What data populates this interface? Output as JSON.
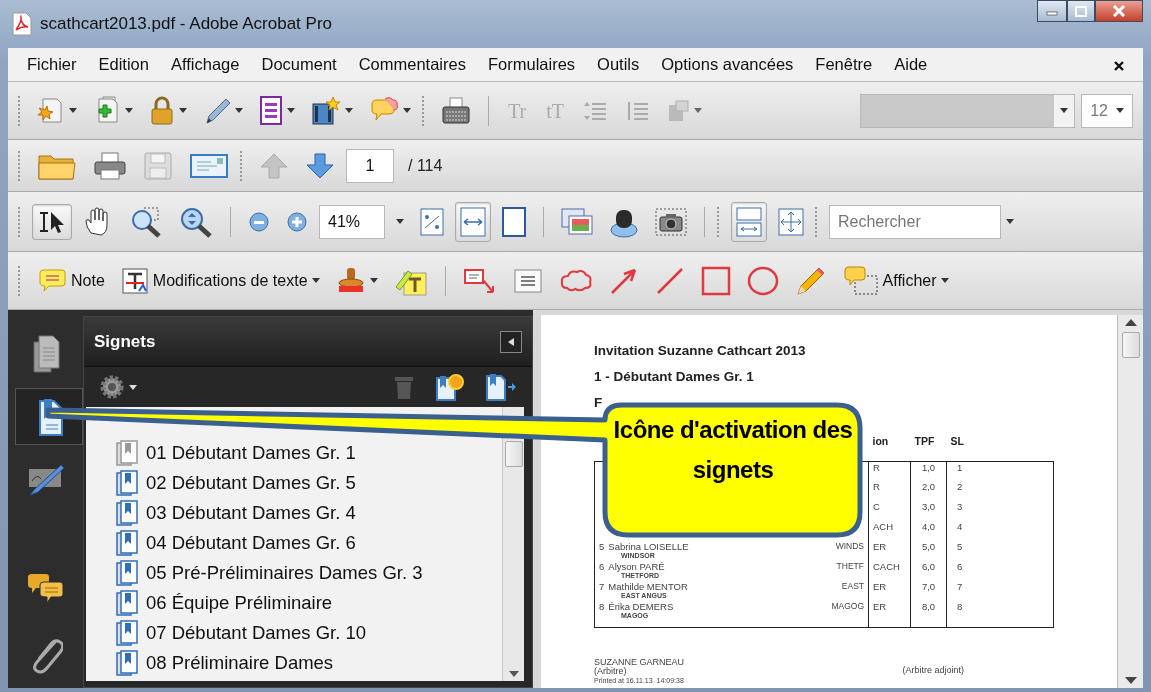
{
  "window": {
    "title": "scathcart2013.pdf - Adobe Acrobat Pro"
  },
  "menu": [
    "Fichier",
    "Edition",
    "Affichage",
    "Document",
    "Commentaires",
    "Formulaires",
    "Outils",
    "Options avancées",
    "Fenêtre",
    "Aide"
  ],
  "text_tools": [
    "Tr",
    "tT"
  ],
  "font_size_field": {
    "value": "12"
  },
  "page_nav": {
    "page": "1",
    "total": "/ 114"
  },
  "view_buttons": [
    {
      "selected": true
    },
    {
      "selected": false
    },
    {
      "selected": false
    },
    {
      "selected": false
    }
  ],
  "zoom_field": {
    "value": "41%"
  },
  "fit_buttons": [
    {
      "selected": false
    },
    {
      "selected": true
    },
    {
      "selected": false
    }
  ],
  "display_buttons": [
    {
      "selected": false
    },
    {
      "selected": false
    },
    {
      "selected": false
    },
    {
      "selected": true
    },
    {
      "selected": false
    }
  ],
  "search": {
    "placeholder": "Rechercher"
  },
  "comment_toolbar": {
    "note": "Note",
    "text_edits": "Modifications de texte",
    "show": "Afficher"
  },
  "sidebar": {
    "items": [
      {
        "selected": false
      },
      {
        "selected": true
      },
      {
        "selected": false
      },
      {
        "selected": false
      },
      {
        "selected": false
      }
    ]
  },
  "bookmarks_panel": {
    "title": "Signets",
    "items": [
      "01 Débutant Dames Gr. 1",
      "02 Débutant Dames Gr. 5",
      "03 Débutant Dames Gr. 4",
      "04 Débutant Dames Gr. 6",
      "05 Pré-Préliminaires Dames Gr. 3",
      "06 Équipe Préliminaire",
      "07 Débutant Dames Gr. 10",
      "08 Préliminaire Dames"
    ]
  },
  "document": {
    "title": "Invitation Suzanne Cathcart 2013",
    "subtitle": "1 - Débutant Dames Gr. 1",
    "heading_fragment": "F",
    "columns": [
      "ion",
      "TPF",
      "SL"
    ],
    "rows": [
      {
        "cat": "R",
        "tpf": "1,0",
        "sl": "1"
      },
      {
        "cat": "R",
        "tpf": "2,0",
        "sl": "2"
      },
      {
        "cat": "C",
        "tpf": "3,0",
        "sl": "3"
      },
      {
        "cat": "ACH",
        "tpf": "4,0",
        "sl": "4"
      },
      {
        "num": "5",
        "name": "Sabrina LOISELLE",
        "city": "WINDSOR",
        "code": "WINDS",
        "cat": "ER",
        "tpf": "5,0",
        "sl": "5"
      },
      {
        "num": "6",
        "name": "Alyson PARÉ",
        "city": "THETFORD",
        "code": "THETF",
        "cat": "CACH",
        "tpf": "6,0",
        "sl": "6"
      },
      {
        "num": "7",
        "name": "Mathilde MENTOR",
        "city": "EAST ANGUS",
        "code": "EAST",
        "cat": "ER",
        "tpf": "7,0",
        "sl": "7"
      },
      {
        "num": "8",
        "name": "Érika DEMERS",
        "city": "MAGOG",
        "code": "MAGOG",
        "cat": "ER",
        "tpf": "8,0",
        "sl": "8"
      }
    ],
    "referee": "SUZANNE GARNEAU",
    "referee_role": "(Arbitre)",
    "printed": "Printed at 16.11.13  14:09:38",
    "assistant_role": "(Arbitre adjoint)"
  },
  "callout": {
    "text": "Icône d'activation des signets"
  }
}
